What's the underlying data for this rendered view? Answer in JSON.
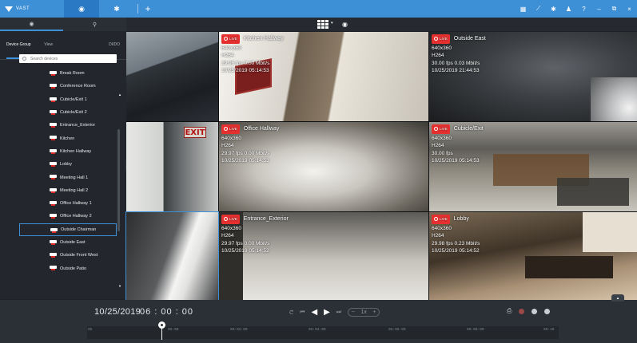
{
  "app": {
    "brand": "VAST"
  },
  "topbar": {
    "tabs": [
      {
        "icon": "eye-icon",
        "glyph": "◉"
      },
      {
        "icon": "gear-icon",
        "glyph": "✱"
      }
    ],
    "add": "+",
    "right_icons": [
      {
        "icon": "statistics-icon",
        "glyph": "▦"
      },
      {
        "icon": "chart-icon",
        "glyph": "⟋"
      },
      {
        "icon": "settings-icon",
        "glyph": "✱"
      },
      {
        "icon": "user-icon",
        "glyph": "♟"
      },
      {
        "icon": "help-icon",
        "glyph": "?"
      },
      {
        "icon": "minimize-icon",
        "glyph": "–"
      },
      {
        "icon": "restore-icon",
        "glyph": "⧉"
      },
      {
        "icon": "close-icon",
        "glyph": "×"
      }
    ]
  },
  "left_panel": {
    "tabs": [
      {
        "icon": "eye-icon",
        "glyph": "◉"
      },
      {
        "icon": "search-icon",
        "glyph": "⚲"
      }
    ],
    "subtabs": {
      "device_group": "Device Group",
      "view": "View",
      "dido": "DI/DO"
    },
    "search_placeholder": "Search devices",
    "devices": [
      "Break Room",
      "Conference Room",
      "Cubicle/Exit 1",
      "Cubicle/Exit 2",
      "Entrance_Exterior",
      "Kitchen",
      "Kitchen Hallway",
      "Lobby",
      "Meeting Hall 1",
      "Meeting Hall 2",
      "Office Hallway 1",
      "Office Hallway 2",
      "Outside Chairman",
      "Outside East",
      "Outside Front West",
      "Outside Patio"
    ],
    "selected_device": "Outside Chairman"
  },
  "grid_toolbar": {
    "layout_caret": "▾",
    "eye": "◉"
  },
  "live_badge": "LIVE",
  "cameras": [
    {
      "scene": "parking"
    },
    {
      "scene": "hallway",
      "name": "Kitchen Hallway",
      "res": "640x360",
      "codec": "H264",
      "rate": "29.96 fps  0.00 Mbit/s",
      "time": "10/25/2019 05:14:53"
    },
    {
      "scene": "nightgarden",
      "name": "Outside East",
      "res": "640x360",
      "codec": "H264",
      "rate": "30.00 fps  0.03 Mbit/s",
      "time": "10/25/2019 21:44:53"
    },
    {
      "scene": "exit",
      "sign": "EXIT"
    },
    {
      "scene": "corridor",
      "name": "Office Hallway",
      "res": "640x360",
      "codec": "H264",
      "rate": "29.97 fps  0.00 Mbit/s",
      "time": "10/25/2019 05:14:53"
    },
    {
      "scene": "office",
      "name": "Cubicle/Exit",
      "res": "640x360",
      "codec": "H264",
      "rate": "30.00 fps",
      "time": "10/25/2019 05:14:53"
    },
    {
      "scene": "door"
    },
    {
      "scene": "lobbyfloor",
      "name": "Entrance_Exterior",
      "res": "640x360",
      "codec": "H264",
      "rate": "29.97 fps  0.00 Mbit/s",
      "time": "10/25/2019 05:14:52"
    },
    {
      "scene": "lobby",
      "name": "Lobby",
      "res": "640x360",
      "codec": "H264",
      "rate": "29.98 fps  0.23 Mbit/s",
      "time": "10/25/2019 05:14:52"
    }
  ],
  "playback": {
    "date": "10/25/2019",
    "time": "06 : 00 : 00",
    "controls": {
      "sync": "ᕦ",
      "first": "⏮",
      "prev": "◀",
      "play": "▶",
      "last": "⏭"
    },
    "speed": {
      "minus": "−",
      "value": "1x",
      "plus": "+"
    },
    "right": {
      "export": "⎙",
      "zoom_out": "−",
      "zoom_in": "+"
    },
    "timeline_ticks": [
      "05",
      "06:00",
      "06:02:00",
      "06:04:00",
      "06:06:00",
      "06:08:00",
      "06:10"
    ],
    "expand": "▴"
  }
}
